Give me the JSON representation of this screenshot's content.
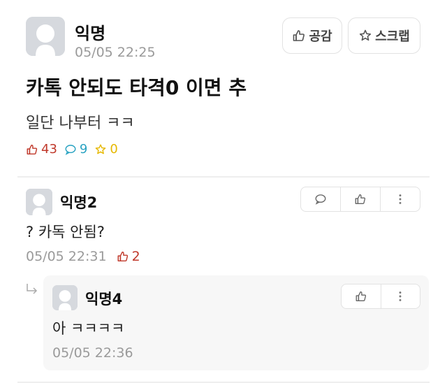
{
  "post": {
    "author": "익명",
    "time": "05/05 22:25",
    "like_button": "공감",
    "scrap_button": "스크랩",
    "title": "카톡 안되도 타격0 이면 추",
    "body": "일단 나부터 ㅋㅋ",
    "stats": {
      "likes": "43",
      "comments": "9",
      "scraps": "0"
    }
  },
  "comment": {
    "author": "익명2",
    "body": "? 카독 안됨?",
    "time": "05/05 22:31",
    "likes": "2"
  },
  "reply": {
    "author": "익명4",
    "body": "아 ㅋㅋㅋㅋ",
    "time": "05/05 22:36"
  },
  "icons": {
    "avatar": "anonymous-avatar-icon",
    "like": "thumbs-up-icon",
    "scrap": "star-icon",
    "comment": "speech-bubble-icon",
    "more": "vertical-dots-icon",
    "reply": "reply-arrow-icon"
  },
  "colors": {
    "like": "#c0392b",
    "comment": "#2aa3c2",
    "scrap": "#e6b800",
    "muted": "#9a9a9a"
  }
}
